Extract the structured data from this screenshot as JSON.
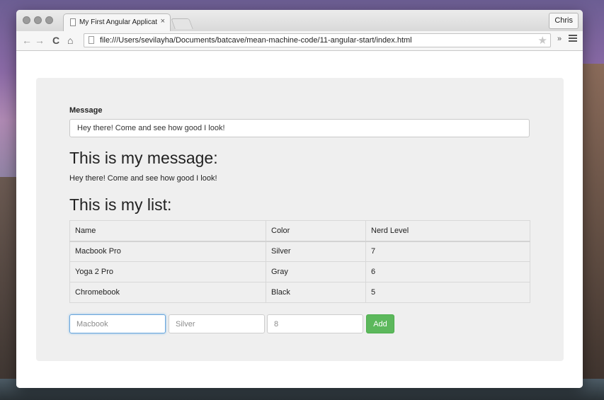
{
  "browser": {
    "tab_title": "My First Angular Applicatio",
    "tab_close": "×",
    "user_name": "Chris",
    "url": "file:///Users/sevilayha/Documents/batcave/mean-machine-code/11-angular-start/index.html",
    "extensions_glyph": "»"
  },
  "form": {
    "message_label": "Message",
    "message_value": "Hey there! Come and see how good I look!"
  },
  "message_section": {
    "heading": "This is my message:",
    "text": "Hey there! Come and see how good I look!"
  },
  "list_section": {
    "heading": "This is my list:",
    "columns": [
      "Name",
      "Color",
      "Nerd Level"
    ],
    "rows": [
      [
        "Macbook Pro",
        "Silver",
        "7"
      ],
      [
        "Yoga 2 Pro",
        "Gray",
        "6"
      ],
      [
        "Chromebook",
        "Black",
        "5"
      ]
    ]
  },
  "add_form": {
    "name_placeholder": "Macbook",
    "color_placeholder": "Silver",
    "level_placeholder": "8",
    "add_label": "Add"
  },
  "colors": {
    "add_button": "#5cb85c",
    "well_background": "#efefef"
  }
}
